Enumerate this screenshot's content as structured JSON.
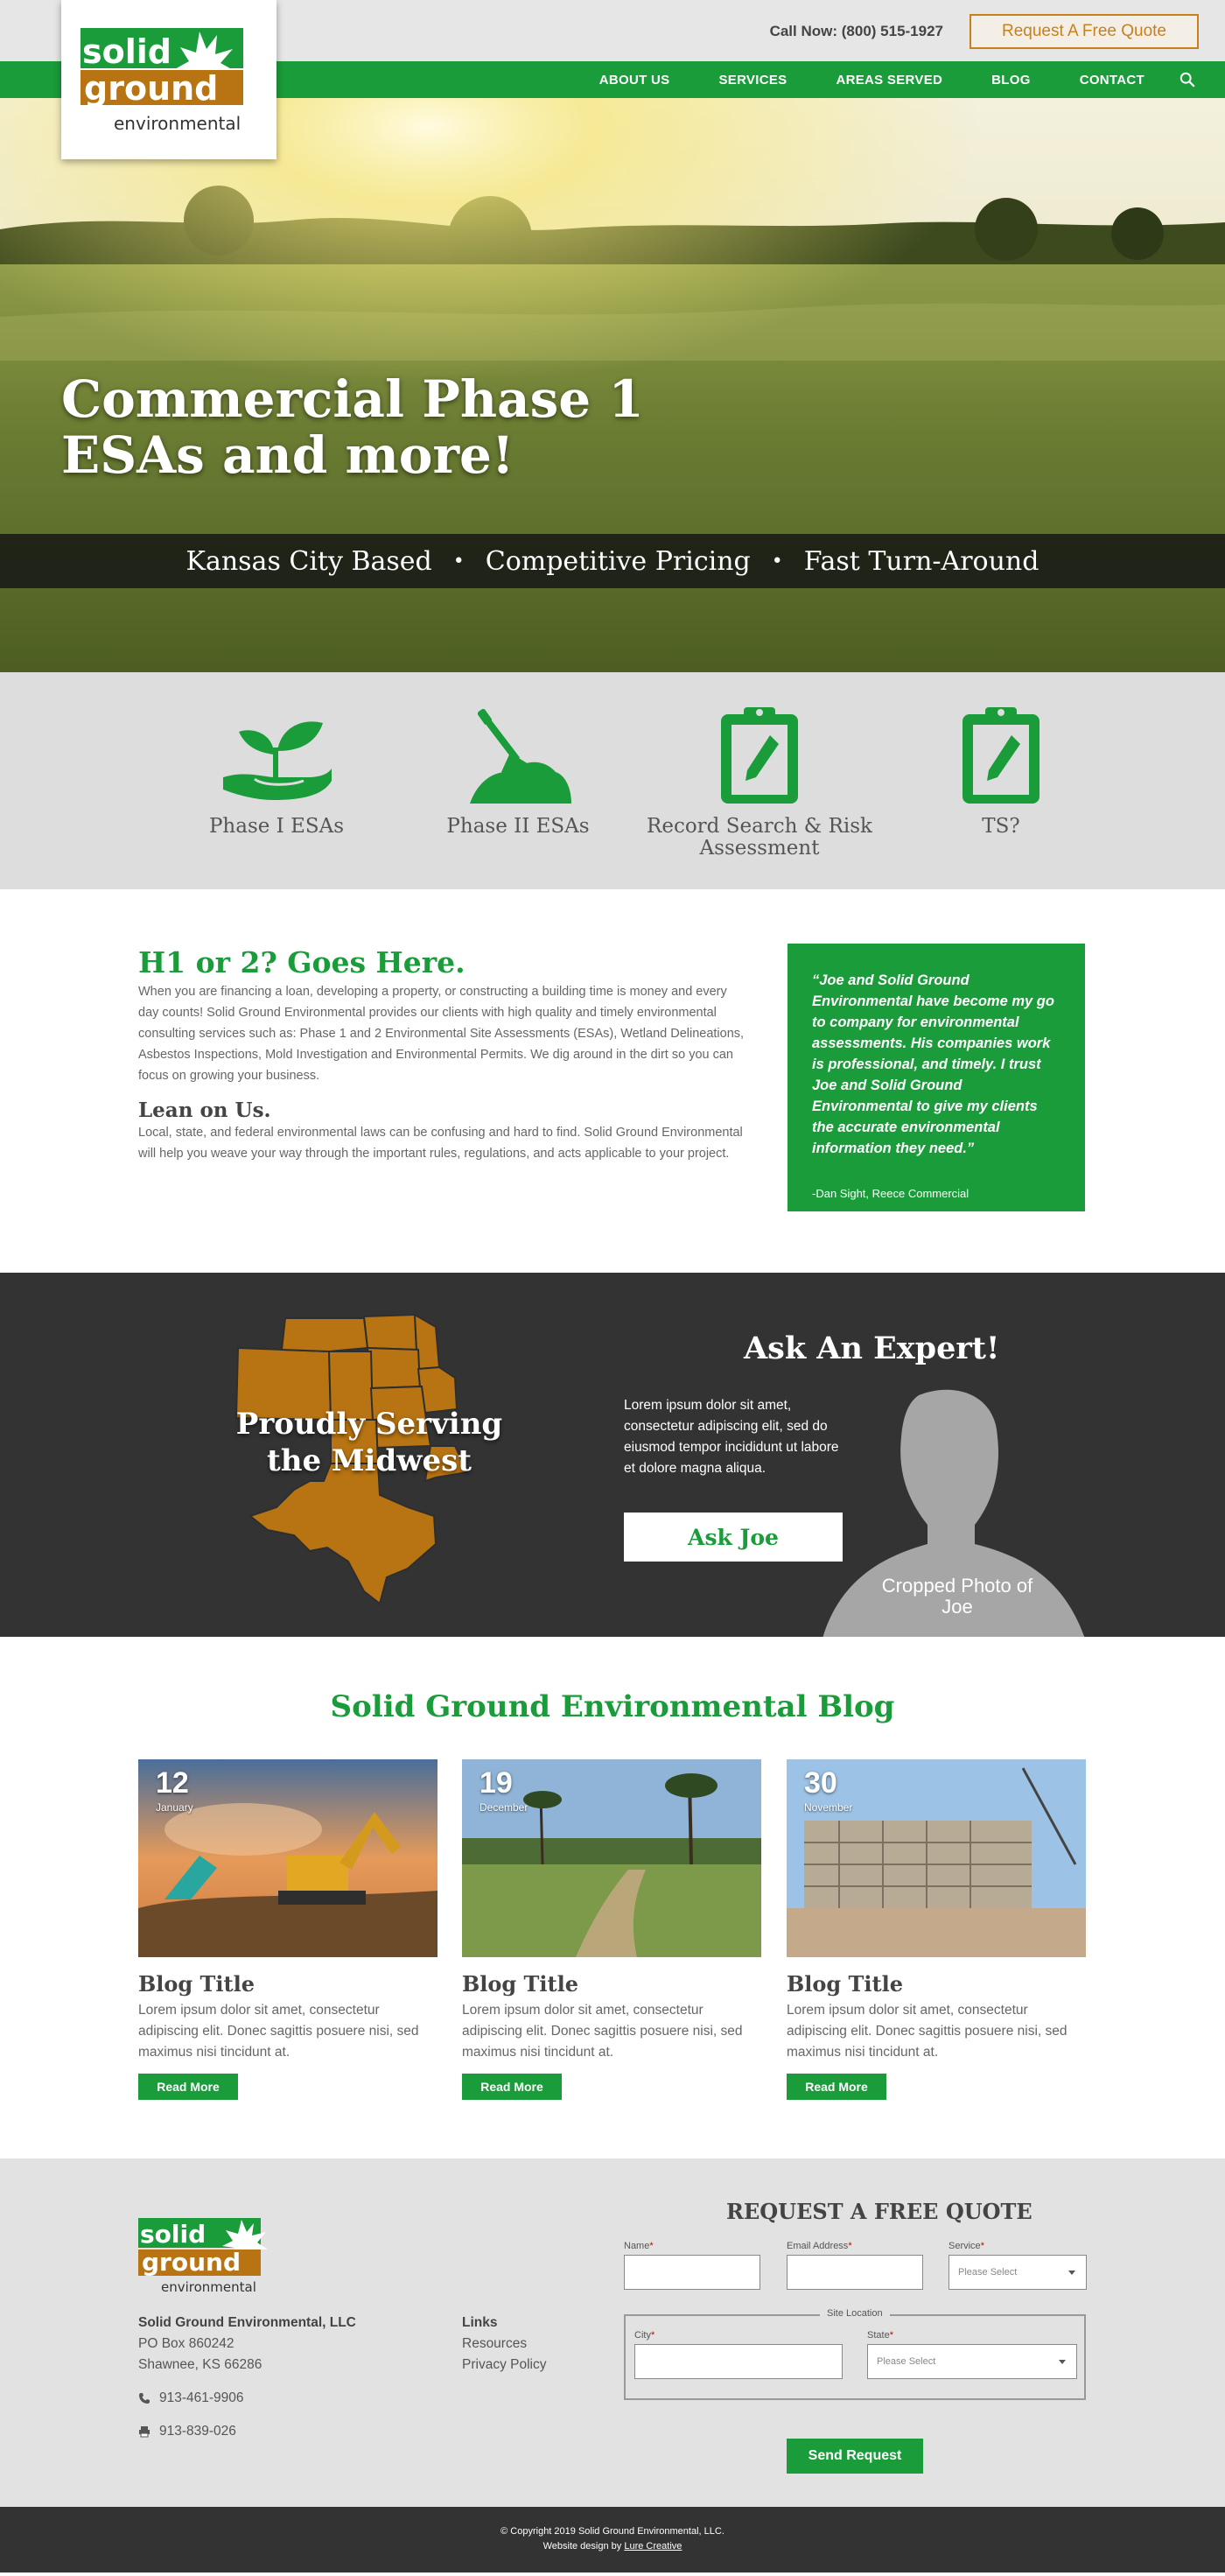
{
  "header": {
    "call_text": "Call Now: (800) 515-1927",
    "quote_button": "Request A Free Quote",
    "nav": [
      "ABOUT US",
      "SERVICES",
      "AREAS SERVED",
      "BLOG",
      "CONTACT"
    ],
    "logo": {
      "line1": "solid",
      "line2": "ground",
      "line3": "environmental"
    }
  },
  "hero": {
    "title": "Commercial Phase 1 ESAs and more!",
    "highlights": [
      "Kansas City Based",
      "Competitive Pricing",
      "Fast Turn-Around"
    ],
    "separator": "•"
  },
  "services": [
    {
      "label": "Phase I ESAs",
      "icon": "seedling-hand-icon"
    },
    {
      "label": "Phase II ESAs",
      "icon": "shovel-dirt-icon"
    },
    {
      "label": "Record Search & Risk Assessment",
      "icon": "clipboard-pencil-icon"
    },
    {
      "label": "TS?",
      "icon": "clipboard-pencil-icon"
    }
  ],
  "intro": {
    "heading": "H1 or 2? Goes Here.",
    "paragraph": "When you are financing a loan, developing a property, or constructing a building time is money and every day counts! Solid Ground Environmental provides our clients with high quality and timely environmental consulting services such as: Phase 1 and 2 Environmental Site Assessments (ESAs), Wetland Delineations, Asbestos Inspections, Mold Investigation and Environmental Permits. We dig around in the dirt so you can focus on growing your business.",
    "subheading": "Lean on Us.",
    "paragraph2": "Local, state, and federal environmental laws can be confusing and hard to find. Solid Ground Environmental will help you weave your way through the important rules, regulations, and acts applicable to your project."
  },
  "testimonial": {
    "quote": "“Joe and Solid Ground Environmental have become my go to company for environmental assessments. His companies work is professional, and timely. I trust Joe and Solid Ground Environmental to give my clients the accurate environmental information they need.”",
    "author": "-Dan Sight, Reece Commercial"
  },
  "midwest": {
    "map_text": "Proudly Serving the Midwest",
    "expert_title": "Ask An Expert!",
    "expert_text": "Lorem ipsum dolor sit amet, consectetur adipiscing elit, sed do eiusmod tempor incididunt ut labore et dolore magna aliqua.",
    "button": "Ask Joe",
    "photo_caption": "Cropped Photo of Joe",
    "map_color": "#b87412"
  },
  "blog": {
    "heading": "Solid Ground Environmental Blog",
    "posts": [
      {
        "day": "12",
        "month": "January",
        "title": "Blog Title",
        "excerpt": "Lorem ipsum dolor sit amet, consectetur adipiscing elit. Donec sagittis posuere nisi, sed maximus nisi tincidunt at.",
        "button": "Read More"
      },
      {
        "day": "19",
        "month": "December",
        "title": "Blog Title",
        "excerpt": "Lorem ipsum dolor sit amet, consectetur adipiscing elit. Donec sagittis posuere nisi, sed maximus nisi tincidunt at.",
        "button": "Read More"
      },
      {
        "day": "30",
        "month": "November",
        "title": "Blog Title",
        "excerpt": "Lorem ipsum dolor sit amet, consectetur adipiscing elit. Donec sagittis posuere nisi, sed maximus nisi tincidunt at.",
        "button": "Read More"
      }
    ]
  },
  "footer": {
    "company": "Solid Ground Environmental, LLC",
    "address1": "PO Box 860242",
    "address2": "Shawnee, KS 66286",
    "phone": "913-461-9906",
    "fax": "913-839-026",
    "links_heading": "Links",
    "links": [
      "Resources",
      "Privacy Policy"
    ],
    "form": {
      "title": "REQUEST A FREE QUOTE",
      "name_label": "Name",
      "email_label": "Email Address",
      "service_label": "Service",
      "service_placeholder": "Please Select",
      "site_location": "Site Location",
      "city_label": "City",
      "state_label": "State",
      "state_placeholder": "Please Select",
      "required_mark": "*",
      "submit": "Send Request"
    }
  },
  "copyright": {
    "line1": "© Copyright 2019 Solid Ground Environmental, LLC.",
    "line2_prefix": "Website design by ",
    "credit": "Lure Creative"
  },
  "colors": {
    "green": "#1a9c3a",
    "brown": "#b87412",
    "dark": "#333333"
  }
}
